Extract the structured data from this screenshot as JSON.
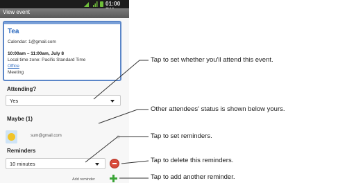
{
  "status_bar": {
    "time": "01:00 PM"
  },
  "title_bar": {
    "title": "View event"
  },
  "event": {
    "title": "Tea",
    "calendar": "Calendar: 1@gmail.com",
    "time": "10:00am – 11:00am, July 8",
    "timezone": "Local time zone:  Pacific Standard Time",
    "location": "Office",
    "description": "Meeting"
  },
  "attending": {
    "label": "Attending?",
    "value": "Yes"
  },
  "maybe": {
    "label": "Maybe (1)",
    "attendee_email": "sum@gmail.com"
  },
  "reminders": {
    "label": "Reminders",
    "value": "10 minutes",
    "add_label": "Add reminder"
  },
  "callouts": [
    "Tap to set whether you'll attend this event.",
    "Other attendees' status is shown below yours.",
    "Tap to set reminders.",
    "Tap to delete this reminders.",
    "Tap to add another reminder."
  ],
  "colors": {
    "accent": "#2e6bc0",
    "remove": "#d84a3a",
    "add": "#3aa436"
  }
}
